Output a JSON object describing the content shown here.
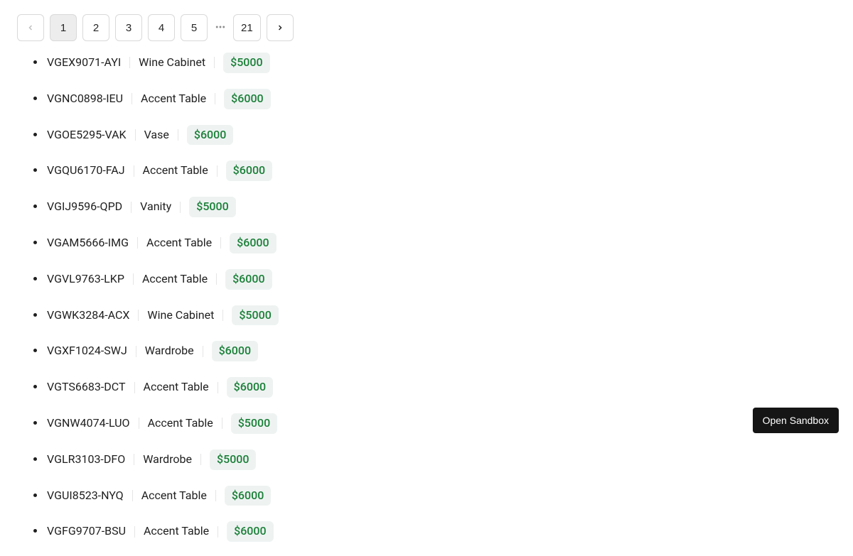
{
  "pagination": {
    "prev_disabled": true,
    "pages": [
      "1",
      "2",
      "3",
      "4",
      "5"
    ],
    "ellipsis": "•••",
    "last_page": "21",
    "active": "1"
  },
  "products": [
    {
      "sku": "VGEX9071-AYI",
      "name": "Wine Cabinet",
      "price": "$5000"
    },
    {
      "sku": "VGNC0898-IEU",
      "name": "Accent Table",
      "price": "$6000"
    },
    {
      "sku": "VGOE5295-VAK",
      "name": "Vase",
      "price": "$6000"
    },
    {
      "sku": "VGQU6170-FAJ",
      "name": "Accent Table",
      "price": "$6000"
    },
    {
      "sku": "VGIJ9596-QPD",
      "name": "Vanity",
      "price": "$5000"
    },
    {
      "sku": "VGAM5666-IMG",
      "name": "Accent Table",
      "price": "$6000"
    },
    {
      "sku": "VGVL9763-LKP",
      "name": "Accent Table",
      "price": "$6000"
    },
    {
      "sku": "VGWK3284-ACX",
      "name": "Wine Cabinet",
      "price": "$5000"
    },
    {
      "sku": "VGXF1024-SWJ",
      "name": "Wardrobe",
      "price": "$6000"
    },
    {
      "sku": "VGTS6683-DCT",
      "name": "Accent Table",
      "price": "$6000"
    },
    {
      "sku": "VGNW4074-LUO",
      "name": "Accent Table",
      "price": "$5000"
    },
    {
      "sku": "VGLR3103-DFO",
      "name": "Wardrobe",
      "price": "$5000"
    },
    {
      "sku": "VGUI8523-NYQ",
      "name": "Accent Table",
      "price": "$6000"
    },
    {
      "sku": "VGFG9707-BSU",
      "name": "Accent Table",
      "price": "$6000"
    }
  ],
  "sandbox_button": "Open Sandbox"
}
